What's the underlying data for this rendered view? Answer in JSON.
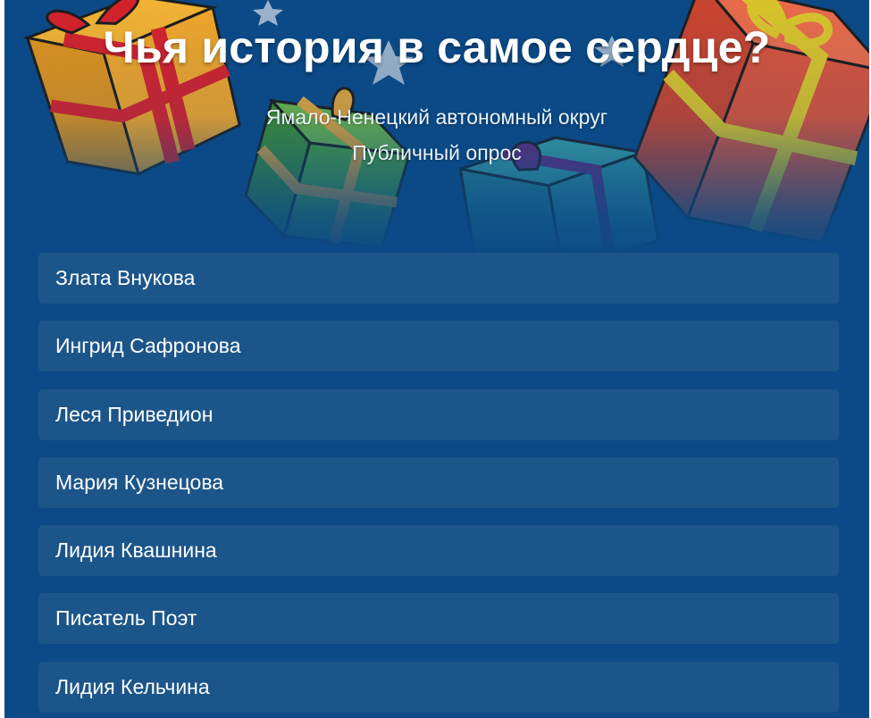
{
  "poll": {
    "title": "Чья история в самое сердце?",
    "region": "Ямало-Ненецкий автономный округ",
    "kind": "Публичный опрос"
  },
  "options": [
    "Злата Внукова",
    "Ингрид Сафронова",
    "Леся Приведион",
    "Мария Кузнецова",
    "Лидия Квашнина",
    "Писатель Поэт",
    "Лидия Кельчина"
  ],
  "colors": {
    "background": "#0b4a86",
    "option_bg": "#1c5589",
    "text": "#ffffff"
  },
  "decoration": {
    "icons": [
      "gift-box-orange-icon",
      "gift-box-green-icon",
      "gift-box-teal-icon",
      "gift-box-red-icon",
      "star-icon"
    ]
  }
}
